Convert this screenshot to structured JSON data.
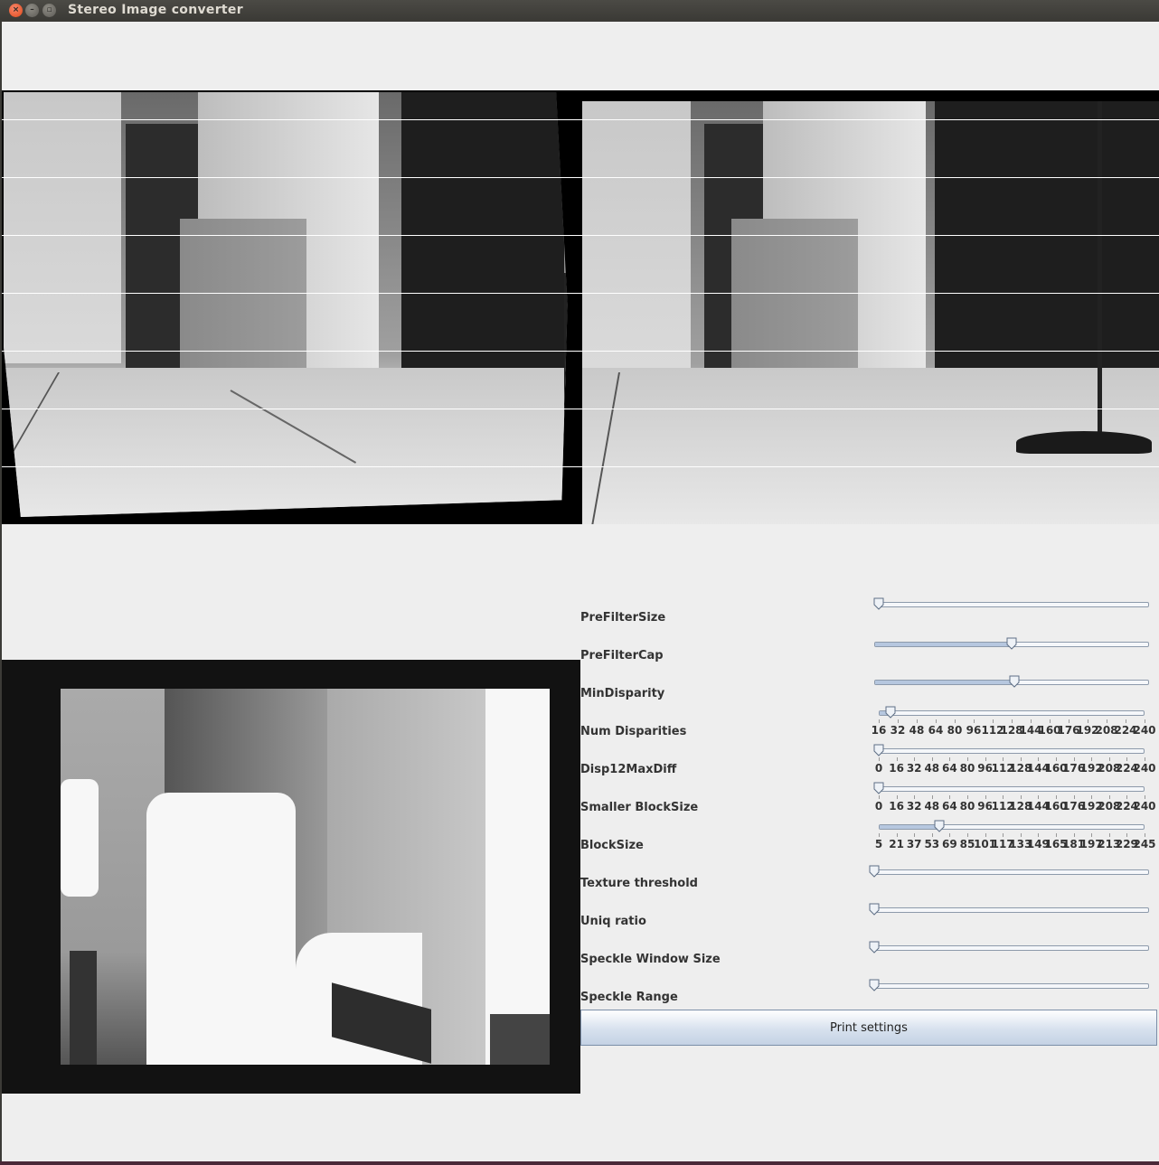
{
  "window": {
    "title": "Stereo Image converter"
  },
  "params": [
    {
      "label": "PreFilterSize",
      "min": 0,
      "max": 100,
      "value": 0
    },
    {
      "label": "PreFilterCap",
      "min": 0,
      "max": 100,
      "value": 50
    },
    {
      "label": "MinDisparity",
      "min": 0,
      "max": 100,
      "value": 51
    },
    {
      "label": "Num Disparities",
      "min": 16,
      "max": 240,
      "value": 26,
      "ticks": [
        "16",
        "32",
        "48",
        "64",
        "80",
        "96",
        "112",
        "128",
        "144",
        "160",
        "176",
        "192",
        "208",
        "224",
        "240"
      ]
    },
    {
      "label": "Disp12MaxDiff",
      "min": 0,
      "max": 240,
      "value": 0,
      "ticks": [
        "0",
        "16",
        "32",
        "48",
        "64",
        "80",
        "96",
        "112",
        "128",
        "144",
        "160",
        "176",
        "192",
        "208",
        "224",
        "240"
      ]
    },
    {
      "label": "Smaller BlockSize",
      "min": 0,
      "max": 240,
      "value": 0,
      "ticks": [
        "0",
        "16",
        "32",
        "48",
        "64",
        "80",
        "96",
        "112",
        "128",
        "144",
        "160",
        "176",
        "192",
        "208",
        "224",
        "240"
      ]
    },
    {
      "label": "BlockSize",
      "min": 5,
      "max": 245,
      "value": 60,
      "ticks": [
        "5",
        "21",
        "37",
        "53",
        "69",
        "85",
        "101",
        "117",
        "133",
        "149",
        "165",
        "181",
        "197",
        "213",
        "229",
        "245"
      ]
    },
    {
      "label": "Texture threshold",
      "min": 0,
      "max": 100,
      "value": 0
    },
    {
      "label": "Uniq ratio",
      "min": 0,
      "max": 100,
      "value": 0
    },
    {
      "label": "Speckle Window Size",
      "min": 0,
      "max": 100,
      "value": 0
    },
    {
      "label": "Speckle Range",
      "min": 0,
      "max": 100,
      "value": 0
    }
  ],
  "print_button": {
    "label": "Print settings"
  },
  "images": {
    "rectified_pair": "rectified-stereo-image",
    "disparity": "disparity-map-image"
  },
  "colors": {
    "accent": "#b6c7df",
    "window_bg": "#eeeeee",
    "titlebar": "#3c3b37"
  }
}
